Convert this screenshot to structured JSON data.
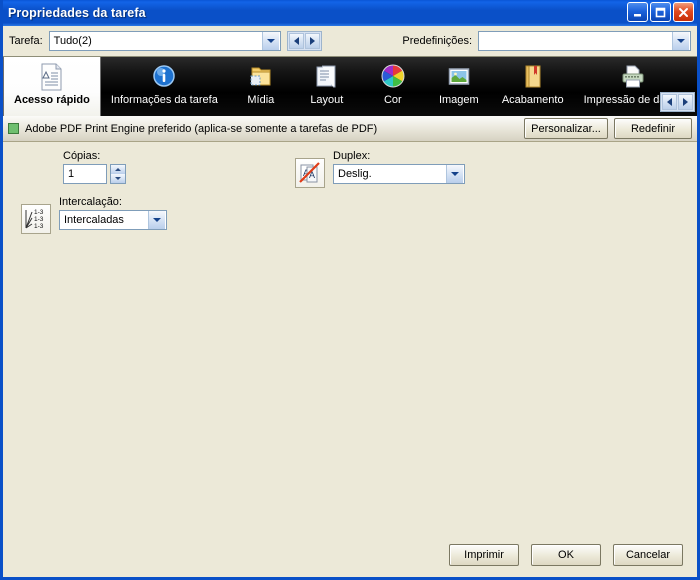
{
  "window": {
    "title": "Propriedades da tarefa",
    "controls": {
      "minimize": "minimize-icon",
      "maximize": "maximize-icon",
      "close": "close-icon"
    }
  },
  "taskbar": {
    "task_label": "Tarefa:",
    "task_value": "Tudo(2)",
    "preset_label": "Predefinições:",
    "preset_value": "",
    "nav_prev": "prev-arrow-icon",
    "nav_next": "next-arrow-icon"
  },
  "tabs": [
    {
      "label": "Acesso rápido",
      "icon": "document-page-icon",
      "selected": true
    },
    {
      "label": "Informações da tarefa",
      "icon": "info-circle-icon",
      "selected": false
    },
    {
      "label": "Mídia",
      "icon": "folder-media-icon",
      "selected": false
    },
    {
      "label": "Layout",
      "icon": "layout-pages-icon",
      "selected": false
    },
    {
      "label": "Cor",
      "icon": "color-wheel-icon",
      "selected": false
    },
    {
      "label": "Imagem",
      "icon": "picture-icon",
      "selected": false
    },
    {
      "label": "Acabamento",
      "icon": "book-bookmark-icon",
      "selected": false
    },
    {
      "label": "Impressão de dados",
      "icon": "printer-icon",
      "selected": false
    }
  ],
  "adobe_bar": {
    "status_icon": "green-status-square-icon",
    "text": "Adobe PDF Print Engine preferido (aplica-se somente a tarefas de PDF)",
    "customize_label": "Personalizar...",
    "reset_label": "Redefinir"
  },
  "main": {
    "copies": {
      "label": "Cópias:",
      "value": "1"
    },
    "collation": {
      "label": "Intercalação:",
      "value": "Intercaladas",
      "icon": "collate-1-3-icon"
    },
    "duplex": {
      "label": "Duplex:",
      "value": "Deslig.",
      "icon": "duplex-off-icon"
    }
  },
  "footer": {
    "print_label": "Imprimir",
    "ok_label": "OK",
    "cancel_label": "Cancelar"
  },
  "colors": {
    "title_bar": "#0A50C8",
    "window_bg": "#ECE9D8",
    "tab_strip": "#000000",
    "status_green": "#6FBF6F",
    "accent_red": "#E03C18"
  }
}
